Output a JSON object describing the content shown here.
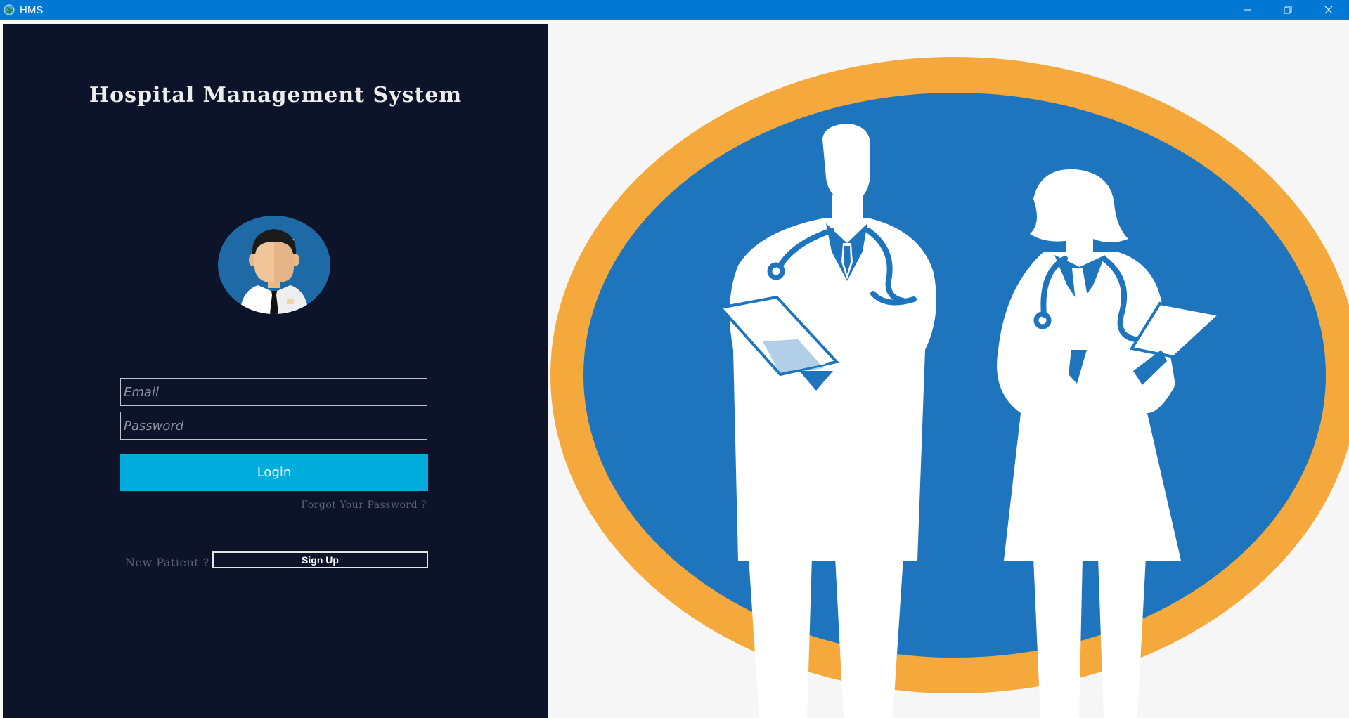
{
  "window": {
    "title": "HMS",
    "controls": [
      "minimize",
      "restore",
      "close"
    ]
  },
  "login": {
    "heading": "Hospital Management System",
    "email_placeholder": "Email",
    "password_placeholder": "Password",
    "login_label": "Login",
    "forgot_label": "Forgot Your Password ?",
    "new_patient_label": "New Patient ?",
    "signup_label": "Sign Up"
  },
  "colors": {
    "titlebar": "#0078d4",
    "panel": "#0d1328",
    "login_button": "#00acdb",
    "emblem_ring": "#f5a93c",
    "emblem_fill": "#1f75bd"
  },
  "icons": {
    "app": "globe-icon",
    "avatar": "doctor-avatar-icon",
    "hero": "doctors-silhouette-illustration"
  }
}
